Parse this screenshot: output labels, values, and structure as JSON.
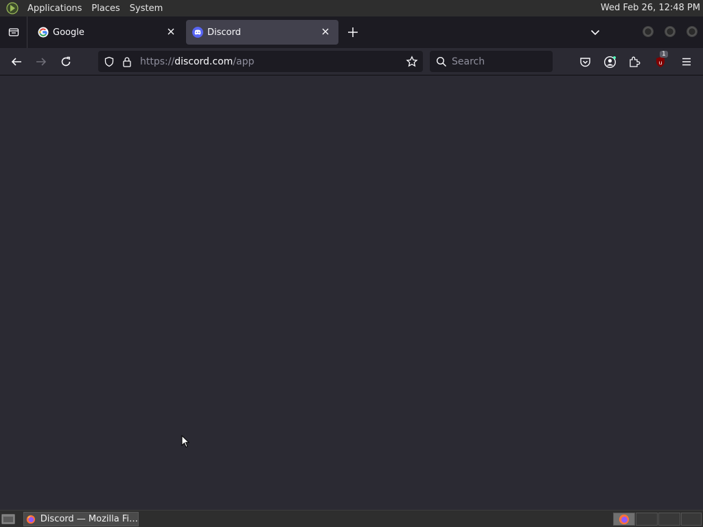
{
  "top_panel": {
    "menus": [
      "Applications",
      "Places",
      "System"
    ],
    "clock": "Wed Feb 26, 12:48 PM"
  },
  "tabs": [
    {
      "title": "Google",
      "favicon": "google-icon",
      "active": false
    },
    {
      "title": "Discord",
      "favicon": "discord-icon",
      "active": true
    }
  ],
  "navbar": {
    "url_prefix": "https://",
    "url_host": "discord.com",
    "url_path": "/app",
    "search_placeholder": "Search",
    "extension_badge": "1"
  },
  "taskbar": {
    "window_title": "Discord — Mozilla Fi…"
  },
  "colors": {
    "chrome_dark": "#1c1b22",
    "chrome": "#2b2a33",
    "active_tab": "#42414d",
    "panel": "#2e2e2e",
    "discord_blurple": "#5865f2"
  }
}
